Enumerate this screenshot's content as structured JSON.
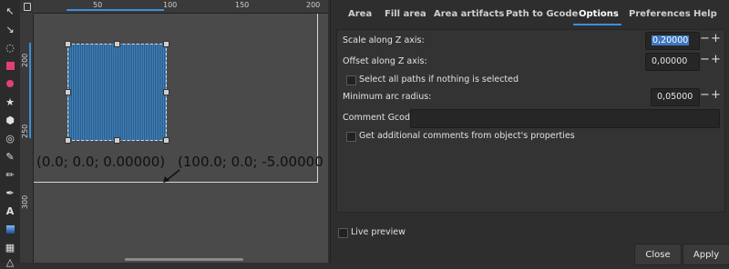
{
  "toolbar": {
    "tools": [
      "selector-tool-icon",
      "node-tool-icon",
      "tweak-tool-icon",
      "rectangle-tool-icon",
      "ellipse-tool-icon",
      "star-tool-icon",
      "box3d-tool-icon",
      "spiral-tool-icon",
      "pen-tool-icon",
      "pencil-tool-icon",
      "calligraphy-tool-icon",
      "text-tool-icon",
      "gradient-tool-icon",
      "mesh-tool-icon",
      "dropper-tool-icon"
    ]
  },
  "rulers": {
    "h_labels": [
      "50",
      "100",
      "150",
      "200"
    ],
    "v_labels": [
      "200",
      "250",
      "300"
    ]
  },
  "canvas": {
    "coord_left": "(0.0; 0.0; 0.00000)",
    "coord_right": "(100.0; 0.0; -5.00000"
  },
  "dialog": {
    "tabs": [
      "Area",
      "Fill area",
      "Area artifacts",
      "Path to Gcode",
      "Options",
      "Preferences",
      "Help"
    ],
    "active_tab": "Options",
    "scale_z": {
      "label": "Scale along Z axis:",
      "value": "0,20000"
    },
    "offset_z": {
      "label": "Offset along Z axis:",
      "value": "0,00000"
    },
    "select_all": {
      "label": "Select all paths if nothing is selected",
      "checked": false
    },
    "min_arc": {
      "label": "Minimum arc radius:",
      "value": "0,05000"
    },
    "comment": {
      "label": "Comment Gcode:",
      "value": ""
    },
    "additional": {
      "label": "Get additional comments from object's properties",
      "checked": false
    },
    "plus": "+",
    "minus": "−",
    "live_preview": {
      "label": "Live preview",
      "checked": false
    },
    "close_label": "Close",
    "apply_label": "Apply"
  },
  "colors": {
    "accent": "#3d8fd8",
    "hatch": "#3f7fb8",
    "canvas": "#4a4a4a"
  }
}
